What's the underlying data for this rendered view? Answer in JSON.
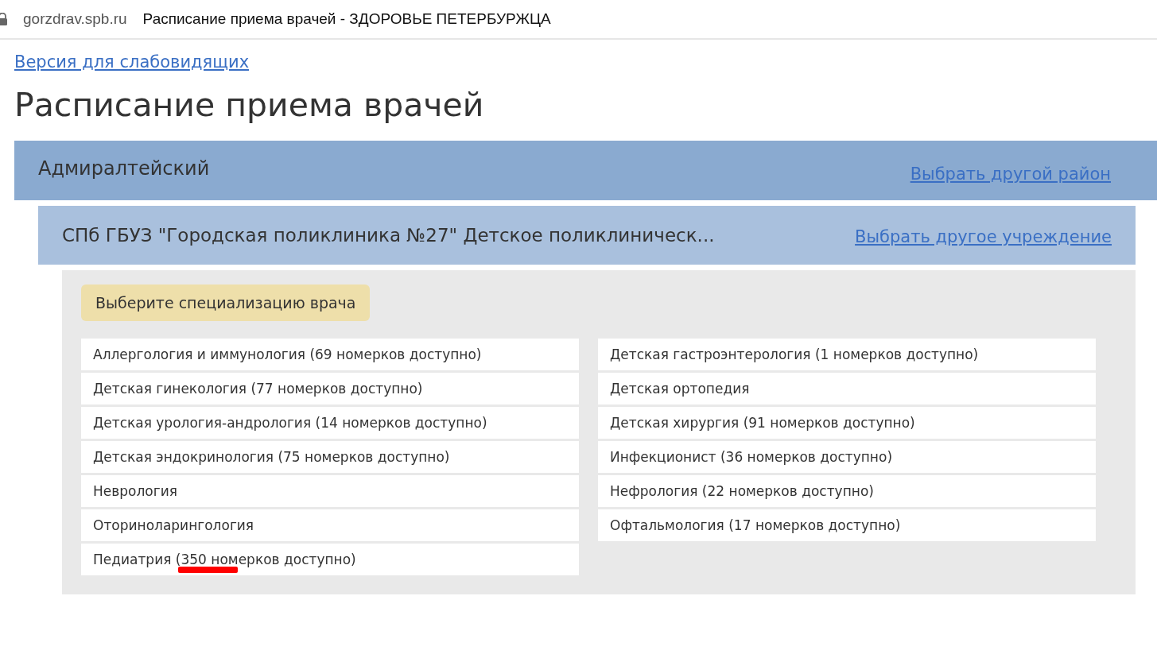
{
  "browser": {
    "url": "gorzdrav.spb.ru",
    "title": "Расписание приема врачей - ЗДОРОВЬЕ ПЕТЕРБУРЖЦА"
  },
  "accessibility_link": "Версия для слабовидящих",
  "heading": "Расписание приема врачей",
  "district": {
    "name": "Адмиралтейский",
    "link": "Выбрать другой район"
  },
  "clinic": {
    "name": "СПб ГБУЗ \"Городская поликлиника №27\" Детское поликлиническ...",
    "link": "Выбрать другое учреждение"
  },
  "prompt": "Выберите специализацию врача",
  "specialties_left": [
    {
      "label": "Аллергология и иммунология (69 номерков доступно)",
      "underlined": false
    },
    {
      "label": "Детская гинекология (77 номерков доступно)",
      "underlined": false
    },
    {
      "label": "Детская урология-андрология (14 номерков доступно)",
      "underlined": false
    },
    {
      "label": "Детская эндокринология (75 номерков доступно)",
      "underlined": false
    },
    {
      "label": "Неврология",
      "underlined": false
    },
    {
      "label": "Оториноларингология",
      "underlined": false
    },
    {
      "label": "Педиатрия (350 номерков доступно)",
      "underlined": true
    }
  ],
  "specialties_right": [
    {
      "label": "Детская гастроэнтерология (1 номерков доступно)",
      "underlined": false
    },
    {
      "label": "Детская ортопедия",
      "underlined": false
    },
    {
      "label": "Детская хирургия (91 номерков доступно)",
      "underlined": false
    },
    {
      "label": "Инфекционист (36 номерков доступно)",
      "underlined": false
    },
    {
      "label": "Нефрология (22 номерков доступно)",
      "underlined": false
    },
    {
      "label": "Офтальмология (17 номерков доступно)",
      "underlined": false
    }
  ]
}
